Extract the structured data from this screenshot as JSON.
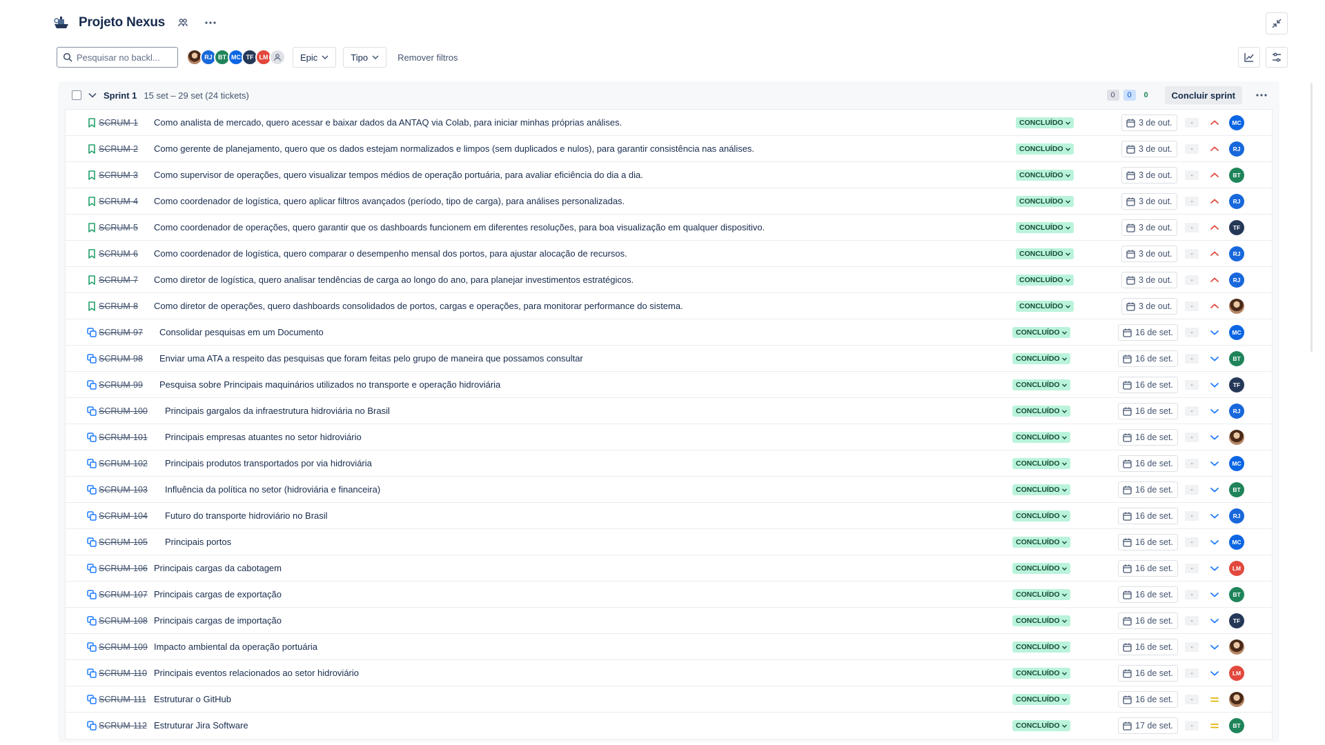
{
  "project": {
    "title": "Projeto Nexus"
  },
  "filters": {
    "search_placeholder": "Pesquisar no backl...",
    "avatars": [
      "",
      "RJ",
      "BT",
      "MC",
      "TF",
      "LM"
    ],
    "epic_label": "Epic",
    "type_label": "Tipo",
    "clear_label": "Remover filtros"
  },
  "sprint": {
    "name": "Sprint 1",
    "dates": "15 set – 29 set (24 tickets)",
    "counts": {
      "todo": "0",
      "in_progress": "0",
      "done": "0"
    },
    "complete_label": "Concluir sprint"
  },
  "issues": [
    {
      "type": "story",
      "key": "SCRUM-1",
      "summary": "Como analista de mercado, quero acessar e baixar dados da ANTAQ via Colab, para iniciar minhas próprias análises.",
      "status": "CONCLUÍDO",
      "due": "3 de out.",
      "priority": "high",
      "assignee": "MC",
      "dash": "-"
    },
    {
      "type": "story",
      "key": "SCRUM-2",
      "summary": "Como gerente de planejamento, quero que os dados estejam normalizados e limpos (sem duplicados e nulos), para garantir consistência nas análises.",
      "status": "CONCLUÍDO",
      "due": "3 de out.",
      "priority": "high",
      "assignee": "RJ",
      "dash": "-"
    },
    {
      "type": "story",
      "key": "SCRUM-3",
      "summary": "Como supervisor de operações, quero visualizar tempos médios de operação portuária, para avaliar eficiência do dia a dia.",
      "status": "CONCLUÍDO",
      "due": "3 de out.",
      "priority": "high",
      "assignee": "BT",
      "dash": "-"
    },
    {
      "type": "story",
      "key": "SCRUM-4",
      "summary": "Como coordenador de logística, quero aplicar filtros avançados (período, tipo de carga), para análises personalizadas.",
      "status": "CONCLUÍDO",
      "due": "3 de out.",
      "priority": "high",
      "assignee": "RJ",
      "dash": "-"
    },
    {
      "type": "story",
      "key": "SCRUM-5",
      "summary": "Como coordenador de operações, quero garantir que os dashboards funcionem em diferentes resoluções, para boa visualização em qualquer dispositivo.",
      "status": "CONCLUÍDO",
      "due": "3 de out.",
      "priority": "high",
      "assignee": "TF",
      "dash": "-"
    },
    {
      "type": "story",
      "key": "SCRUM-6",
      "summary": "Como coordenador de logística, quero comparar o desempenho mensal dos portos, para ajustar alocação de recursos.",
      "status": "CONCLUÍDO",
      "due": "3 de out.",
      "priority": "high",
      "assignee": "RJ",
      "dash": "-"
    },
    {
      "type": "story",
      "key": "SCRUM-7",
      "summary": "Como diretor de logística, quero analisar tendências de carga ao longo do ano, para planejar investimentos estratégicos.",
      "status": "CONCLUÍDO",
      "due": "3 de out.",
      "priority": "high",
      "assignee": "RJ",
      "dash": "-"
    },
    {
      "type": "story",
      "key": "SCRUM-8",
      "summary": "Como diretor de operações, quero dashboards consolidados de portos, cargas e operações, para monitorar performance do sistema.",
      "status": "CONCLUÍDO",
      "due": "3 de out.",
      "priority": "high",
      "assignee": "",
      "dash": "-"
    },
    {
      "type": "subtask",
      "key": "SCRUM-97",
      "summary": "Consolidar pesquisas em um Documento",
      "status": "CONCLUÍDO",
      "due": "16 de set.",
      "priority": "low",
      "assignee": "MC",
      "dash": "-"
    },
    {
      "type": "subtask",
      "key": "SCRUM-98",
      "summary": "Enviar uma ATA a respeito das pesquisas que foram feitas pelo grupo de maneira que possamos consultar",
      "status": "CONCLUÍDO",
      "due": "16 de set.",
      "priority": "low",
      "assignee": "BT",
      "dash": "-"
    },
    {
      "type": "subtask",
      "key": "SCRUM-99",
      "summary": "Pesquisa sobre Principais maquinários utilizados no transporte e operação hidroviária",
      "status": "CONCLUÍDO",
      "due": "16 de set.",
      "priority": "low",
      "assignee": "TF",
      "dash": "-"
    },
    {
      "type": "subtask",
      "key": "SCRUM-100",
      "summary": "Principais gargalos da infraestrutura hidroviária no Brasil",
      "status": "CONCLUÍDO",
      "due": "16 de set.",
      "priority": "low",
      "assignee": "RJ",
      "dash": "-"
    },
    {
      "type": "subtask",
      "key": "SCRUM-101",
      "summary": "Principais empresas atuantes no setor hidroviário",
      "status": "CONCLUÍDO",
      "due": "16 de set.",
      "priority": "low",
      "assignee": "",
      "dash": "-"
    },
    {
      "type": "subtask",
      "key": "SCRUM-102",
      "summary": "Principais produtos transportados por via hidroviária",
      "status": "CONCLUÍDO",
      "due": "16 de set.",
      "priority": "low",
      "assignee": "MC",
      "dash": "-"
    },
    {
      "type": "subtask",
      "key": "SCRUM-103",
      "summary": "Influência da política no setor (hidroviária e financeira)",
      "status": "CONCLUÍDO",
      "due": "16 de set.",
      "priority": "low",
      "assignee": "BT",
      "dash": "-"
    },
    {
      "type": "subtask",
      "key": "SCRUM-104",
      "summary": "Futuro do transporte hidroviário no Brasil",
      "status": "CONCLUÍDO",
      "due": "16 de set.",
      "priority": "low",
      "assignee": "RJ",
      "dash": "-"
    },
    {
      "type": "subtask",
      "key": "SCRUM-105",
      "summary": "Principais portos",
      "status": "CONCLUÍDO",
      "due": "16 de set.",
      "priority": "low",
      "assignee": "MC",
      "dash": "-"
    },
    {
      "type": "subtask",
      "key": "SCRUM-106",
      "summary": "Principais cargas da cabotagem",
      "status": "CONCLUÍDO",
      "due": "16 de set.",
      "priority": "low",
      "assignee": "LM",
      "dash": "-"
    },
    {
      "type": "subtask",
      "key": "SCRUM-107",
      "summary": "Principais cargas de exportação",
      "status": "CONCLUÍDO",
      "due": "16 de set.",
      "priority": "low",
      "assignee": "BT",
      "dash": "-"
    },
    {
      "type": "subtask",
      "key": "SCRUM-108",
      "summary": "Principais cargas de importação",
      "status": "CONCLUÍDO",
      "due": "16 de set.",
      "priority": "low",
      "assignee": "TF",
      "dash": "-"
    },
    {
      "type": "subtask",
      "key": "SCRUM-109",
      "summary": "Impacto ambiental da operação portuária",
      "status": "CONCLUÍDO",
      "due": "16 de set.",
      "priority": "low",
      "assignee": "",
      "dash": "-"
    },
    {
      "type": "subtask",
      "key": "SCRUM-110",
      "summary": "Principais eventos relacionados ao setor hidroviário",
      "status": "CONCLUÍDO",
      "due": "16 de set.",
      "priority": "low",
      "assignee": "LM",
      "dash": "-"
    },
    {
      "type": "subtask",
      "key": "SCRUM-111",
      "summary": "Estruturar o GitHub",
      "status": "CONCLUÍDO",
      "due": "16 de set.",
      "priority": "medium",
      "assignee": "",
      "dash": "-"
    },
    {
      "type": "subtask",
      "key": "SCRUM-112",
      "summary": "Estruturar Jira Software",
      "status": "CONCLUÍDO",
      "due": "17 de set.",
      "priority": "medium",
      "assignee": "BT",
      "dash": "-"
    }
  ],
  "colors": {
    "RJ": "#1868db",
    "BT": "#1f845a",
    "MC": "#0c66e4",
    "TF": "#253858",
    "LM": "#e2483d",
    "story_icon": "#22a06b",
    "subtask_icon": "#1d7afc",
    "priority_high": "#e2483d",
    "priority_low": "#1d7afc",
    "priority_medium": "#e2b203"
  }
}
